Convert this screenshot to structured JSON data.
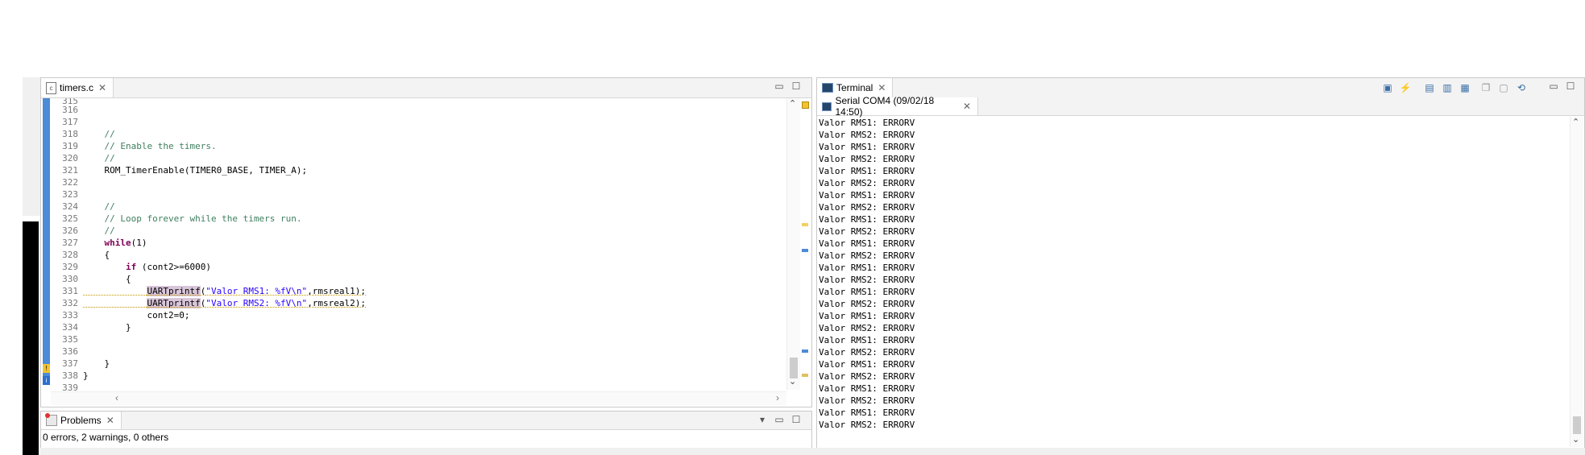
{
  "editor": {
    "tab_label": "timers.c",
    "line_numbers": [
      "315",
      "316",
      "317",
      "318",
      "319",
      "320",
      "321",
      "322",
      "323",
      "324",
      "325",
      "326",
      "327",
      "328",
      "329",
      "330",
      "331",
      "332",
      "333",
      "334",
      "335",
      "336",
      "337",
      "338",
      "339"
    ],
    "lines": {
      "l318": "    //",
      "l319": "    // Enable the timers.",
      "l320": "    //",
      "l321": "    ROM_TimerEnable(TIMER0_BASE, TIMER_A);",
      "l324": "    //",
      "l325": "    // Loop forever while the timers run.",
      "l326": "    //",
      "l327_kw": "while",
      "l327_rest": "(1)",
      "l328": "    {",
      "l329_kw": "if",
      "l329_rest": " (cont2>=6000)",
      "l330": "        {",
      "l331_fn": "UARTprintf",
      "l331_open": "(",
      "l331_str": "\"Valor RMS1: %fV\\n\"",
      "l331_rest": ",rmsreal1);",
      "l332_fn": "UARTprintf",
      "l332_open": "(",
      "l332_str": "\"Valor RMS2: %fV\\n\"",
      "l332_rest": ",rmsreal2);",
      "l333": "            cont2=0;",
      "l334": "        }",
      "l337": "    }",
      "l338": "}"
    }
  },
  "problems": {
    "tab_label": "Problems",
    "summary": "0 errors, 2 warnings, 0 others"
  },
  "terminal": {
    "tab_label": "Terminal",
    "session_label": "Serial COM4 (09/02/18 14:50)",
    "output": [
      "Valor RMS1: ERRORV",
      "Valor RMS2: ERRORV",
      "Valor RMS1: ERRORV",
      "Valor RMS2: ERRORV",
      "Valor RMS1: ERRORV",
      "Valor RMS2: ERRORV",
      "Valor RMS1: ERRORV",
      "Valor RMS2: ERRORV",
      "Valor RMS1: ERRORV",
      "Valor RMS2: ERRORV",
      "Valor RMS1: ERRORV",
      "Valor RMS2: ERRORV",
      "Valor RMS1: ERRORV",
      "Valor RMS2: ERRORV",
      "Valor RMS1: ERRORV",
      "Valor RMS2: ERRORV",
      "Valor RMS1: ERRORV",
      "Valor RMS2: ERRORV",
      "Valor RMS1: ERRORV",
      "Valor RMS2: ERRORV",
      "Valor RMS1: ERRORV",
      "Valor RMS2: ERRORV",
      "Valor RMS1: ERRORV",
      "Valor RMS2: ERRORV",
      "Valor RMS1: ERRORV",
      "Valor RMS2: ERRORV"
    ]
  },
  "icons": {
    "minimize": "▭",
    "maximize": "☐",
    "close": "✕",
    "chevron_down": "▾",
    "scroll_up": "⌃",
    "scroll_down": "⌄",
    "scroll_left": "‹",
    "scroll_right": "›"
  },
  "colors": {
    "gutter": "#4c8bd6",
    "comment": "#3f7f5f",
    "keyword": "#7f0055",
    "string": "#2a00ff"
  }
}
